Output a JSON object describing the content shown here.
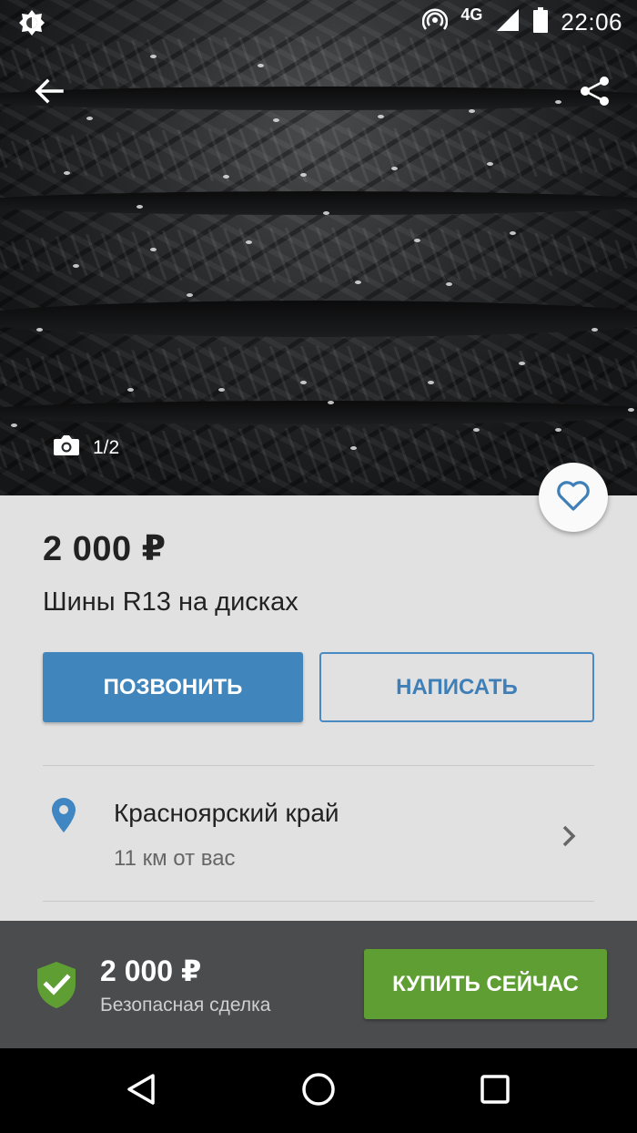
{
  "status_bar": {
    "network": "4G",
    "time": "22:06"
  },
  "gallery": {
    "counter": "1/2"
  },
  "listing": {
    "price": "2 000 ₽",
    "title": "Шины R13 на дисках"
  },
  "actions": {
    "call_label": "ПОЗВОНИТЬ",
    "write_label": "НАПИСАТЬ"
  },
  "location": {
    "region": "Красноярский край",
    "distance": "11 км от вас"
  },
  "bottom_bar": {
    "price": "2 000 ₽",
    "safe_deal": "Безопасная сделка",
    "buy_label": "КУПИТЬ СЕЙЧАС"
  },
  "colors": {
    "primary_blue": "#4185bd",
    "buy_green": "#5e9e33",
    "content_bg": "#e1e1e1",
    "bottom_bar_bg": "#4b4c4d"
  },
  "icons": {
    "status_left": "brightness-icon",
    "back": "arrow-back-icon",
    "share": "share-icon",
    "camera": "camera-icon",
    "favorite": "heart-outline-icon",
    "location": "location-pin-icon",
    "chevron": "chevron-right-icon",
    "safe_deal": "shield-check-icon",
    "nav_back": "nav-back-icon",
    "nav_home": "nav-home-icon",
    "nav_recents": "nav-recents-icon"
  }
}
